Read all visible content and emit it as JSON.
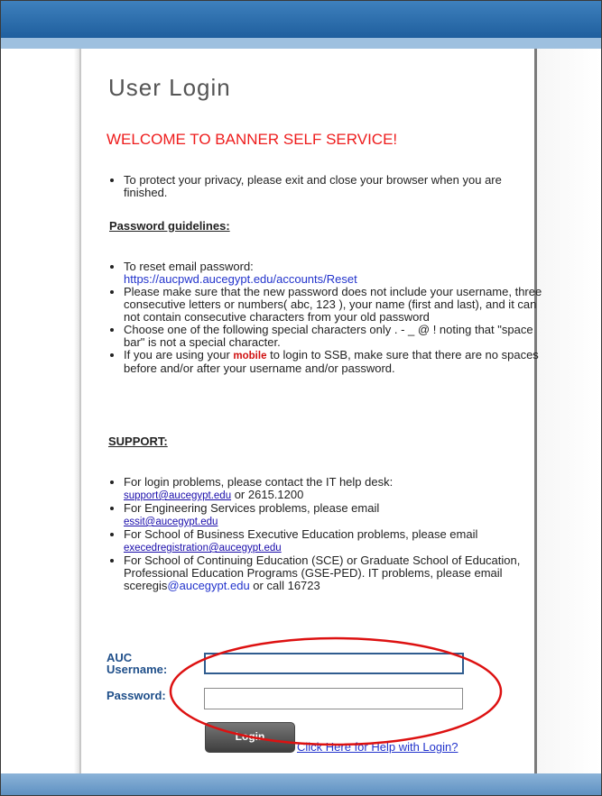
{
  "page": {
    "title": "User Login",
    "welcome": "WELCOME TO BANNER SELF SERVICE!"
  },
  "privacy_notice": "To protect your privacy, please exit and close your browser when you are finished.",
  "password_guidelines": {
    "heading": "Password guidelines:",
    "reset_prefix": "To reset email password: ",
    "reset_url": "https://aucpwd.aucegypt.edu/accounts/Reset",
    "rule_new_password": "Please make sure that the new password does not include your username, three consecutive letters or numbers( abc, 123 ), your name (first and last), and it can not contain consecutive characters from your old password",
    "rule_special_chars": "Choose one of the following special characters only . - _ @ ! noting that \"space bar\" is not a special character.",
    "rule_mobile_prefix": "If you are using your ",
    "rule_mobile_word": "mobile",
    "rule_mobile_suffix": " to login to SSB, make sure that there are no spaces before and/or after your username and/or password."
  },
  "support": {
    "heading": "SUPPORT:",
    "login_problems_prefix": "For login problems, please contact the IT help desk: ",
    "login_problems_email": "support@aucegypt.edu",
    "login_problems_suffix": " or 2615.1200",
    "engineering_prefix": "For Engineering Services problems, please email ",
    "engineering_email": "essit@aucegypt.edu",
    "business_prefix": "For School of Business Executive Education problems, please email ",
    "business_email": "execedregistration@aucegypt.edu",
    "sce_prefix": "For School of Continuing Education (SCE) or Graduate School of Education, Professional Education Programs (GSE-PED). IT problems, please email sceregis",
    "sce_email": "@aucegypt.edu",
    "sce_suffix": " or call 16723"
  },
  "form": {
    "username_label_line1": "AUC",
    "username_label_line2": "Username:",
    "username_value": "",
    "password_label": "Password:",
    "password_value": "",
    "login_button": "Login",
    "help_link": "Click Here for Help with Login?"
  },
  "colors": {
    "header_blue": "#1f5f9e",
    "welcome_red": "#ee1c1c",
    "annotation_red": "#dd1111",
    "label_blue": "#1f4f8a"
  }
}
